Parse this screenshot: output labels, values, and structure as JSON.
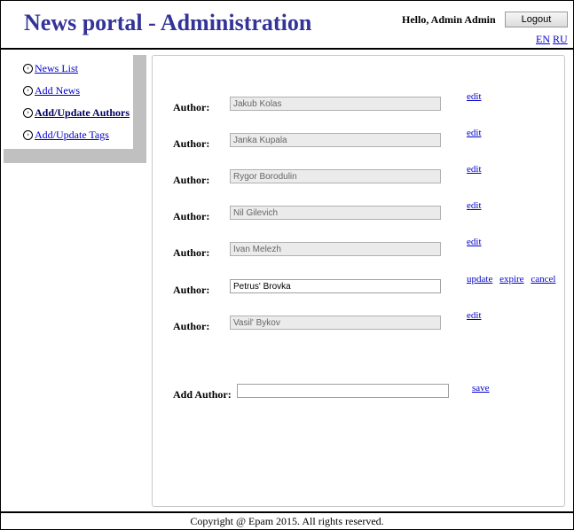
{
  "header": {
    "title": "News portal - Administration",
    "greeting": "Hello, Admin Admin",
    "logout_label": "Logout",
    "lang_en": "EN",
    "lang_ru": "RU"
  },
  "menu": {
    "items": [
      {
        "label": "News List"
      },
      {
        "label": "Add News"
      },
      {
        "label": "Add/Update Authors"
      },
      {
        "label": "Add/Update Tags"
      }
    ]
  },
  "authors": {
    "label": "Author:",
    "rows": [
      {
        "name": "Jakub Kolas",
        "edit": "edit"
      },
      {
        "name": "Janka Kupala",
        "edit": "edit"
      },
      {
        "name": "Rygor Borodulin",
        "edit": "edit"
      },
      {
        "name": "Nil Gilevich",
        "edit": "edit"
      },
      {
        "name": "Ivan Melezh",
        "edit": "edit"
      },
      {
        "name": "Petrus' Brovka",
        "update": "update",
        "expire": "expire",
        "cancel": "cancel"
      },
      {
        "name": "Vasil' Bykov",
        "edit": "edit"
      }
    ]
  },
  "add_author": {
    "label": "Add Author:",
    "value": "",
    "save_label": "save"
  },
  "footer": {
    "text": "Copyright @ Epam 2015. All rights reserved."
  }
}
